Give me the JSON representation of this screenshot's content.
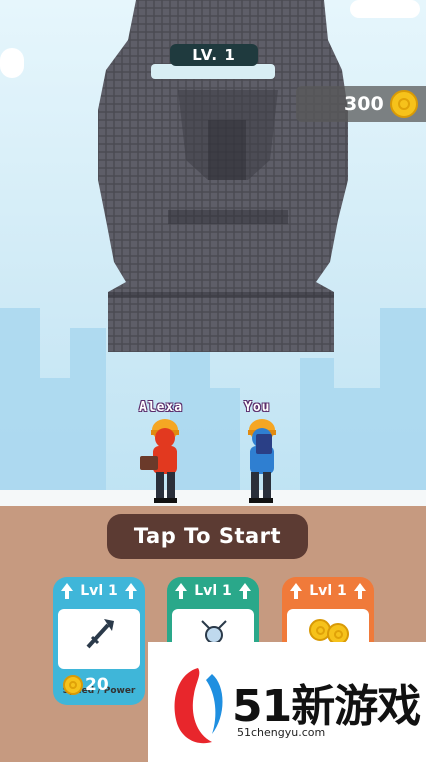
{
  "level": {
    "label": "LV. 1"
  },
  "currency": {
    "coins": "300",
    "icon": "coin-icon"
  },
  "players": [
    {
      "name": "Alexa",
      "shirt": "#e2391f",
      "helmet": "#f5a623"
    },
    {
      "name": "You",
      "shirt": "#2f7fd1",
      "helmet": "#f5a623"
    }
  ],
  "start_button": {
    "label": "Tap To Start"
  },
  "upgrades": [
    {
      "level": "Lvl 1",
      "label": "Speed / Power",
      "cost": "20",
      "color": "#3fb6d9",
      "icon": "hammer-icon"
    },
    {
      "level": "Lvl 1",
      "label": "",
      "cost": "",
      "color": "#2aa88a",
      "icon": "merge-icon"
    },
    {
      "level": "Lvl 1",
      "label": "",
      "cost": "",
      "color": "#f07a3a",
      "icon": "coins-icon"
    }
  ],
  "watermark": {
    "brand": "51新游戏",
    "url": "51chengyu.com"
  }
}
